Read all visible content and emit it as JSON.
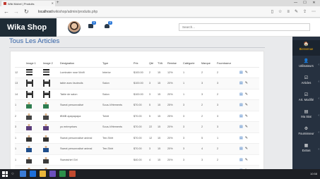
{
  "browser": {
    "tab_title": "Wiki Mobel | Produits",
    "tab_close": "✕",
    "new_tab": "+",
    "url_host": "localhost",
    "url_path": "/wikishop/admin/produits.php",
    "window_controls": [
      "—",
      "☐",
      "✕"
    ]
  },
  "header": {
    "brand": "Wika Shop",
    "messages_badge": "3",
    "notifications_badge": "0",
    "search_placeholder": "Search..."
  },
  "page": {
    "title": "Tous Les Articles"
  },
  "table": {
    "columns": [
      "",
      "Image 1",
      "Image 2",
      "Designation",
      "Type",
      "Prix",
      "Qté",
      "TVA",
      "Remise",
      "Catégorie",
      "Marque",
      "Fournisseur",
      ""
    ],
    "rows": [
      {
        "id": "12",
        "img": "lamp",
        "designation": "Luminaire rose Wolfi",
        "type": "Interior",
        "prix": "$100.00",
        "qte": "2",
        "tva": "15",
        "remise": "12%",
        "cat": "1",
        "marque": "2",
        "four": "2"
      },
      {
        "id": "13",
        "img": "chair",
        "designation": "table avec fauteuils",
        "type": "Salon",
        "prix": "$100.00",
        "qte": "3",
        "tva": "15",
        "remise": "20%",
        "cat": "1",
        "marque": "3",
        "four": "3"
      },
      {
        "id": "14",
        "img": "chair",
        "designation": "Table de salon",
        "type": "Salon",
        "prix": "$100.00",
        "qte": "3",
        "tva": "15",
        "remise": "20%",
        "cat": "1",
        "marque": "3",
        "four": "2"
      },
      {
        "id": "1",
        "img": "person",
        "color": "#2e7d4f",
        "designation": "Sweat personnalisé",
        "type": "Sous-Vêtements",
        "prix": "$70.00",
        "qte": "5",
        "tva": "15",
        "remise": "25%",
        "cat": "3",
        "marque": "2",
        "four": "3"
      },
      {
        "id": "2",
        "img": "person",
        "color": "#444",
        "designation": "tBMB apapapapa",
        "type": "Tshirt",
        "prix": "$70.00",
        "qte": "5",
        "tva": "15",
        "remise": "25%",
        "cat": "3",
        "marque": "2",
        "four": "3"
      },
      {
        "id": "3",
        "img": "person",
        "color": "#5a3d7a",
        "designation": "yo entreprises",
        "type": "Sous-Vêtements",
        "prix": "$70.00",
        "qte": "22",
        "tva": "15",
        "remise": "20%",
        "cat": "3",
        "marque": "2",
        "four": "3"
      },
      {
        "id": "1",
        "img": "person",
        "color": "#333",
        "designation": "Sweat personnalisé animal",
        "type": "Tee-Shirt",
        "prix": "$70.00",
        "qte": "12",
        "tva": "15",
        "remise": "20%",
        "cat": "3",
        "marque": "5",
        "four": "1"
      },
      {
        "id": "1",
        "img": "person",
        "color": "#1f4e8c",
        "designation": "Sweat personnalisé animal",
        "type": "Tee-Shirt",
        "prix": "$70.00",
        "qte": "3",
        "tva": "15",
        "remise": "20%",
        "cat": "3",
        "marque": "4",
        "four": "2"
      },
      {
        "id": "1",
        "img": "person",
        "color": "#3b3b3b",
        "designation": "Sweatshirt Girl",
        "type": "",
        "prix": "$40.00",
        "qte": "4",
        "tva": "15",
        "remise": "20%",
        "cat": "3",
        "marque": "3",
        "four": "2"
      },
      {
        "id": "1",
        "img": "person",
        "color": "#555",
        "designation": "Shirt Vestiaire",
        "type": "Tee-Shirt",
        "prix": "$70.00",
        "qte": "3",
        "tva": "15",
        "remise": "25%",
        "cat": "3",
        "marque": "4",
        "four": "1"
      }
    ]
  },
  "sidebar": {
    "items": [
      {
        "label": "Bienvenue",
        "icon": "🏠"
      },
      {
        "label": "Utilisateurs",
        "icon": "👤"
      },
      {
        "label": "Articles",
        "icon": "☑"
      },
      {
        "label": "Art. Modifié",
        "icon": "☑"
      },
      {
        "label": "Ma Stat",
        "icon": "▤"
      },
      {
        "label": "Fournisseur",
        "icon": "⚙"
      },
      {
        "label": "Extras",
        "icon": "▦"
      }
    ]
  },
  "taskbar": {
    "time": "10:58"
  },
  "colors": {
    "brand_bg": "#1e2b35",
    "sidebar_bg": "#263140",
    "accent": "#2f5fa4",
    "active": "#ffb300"
  }
}
